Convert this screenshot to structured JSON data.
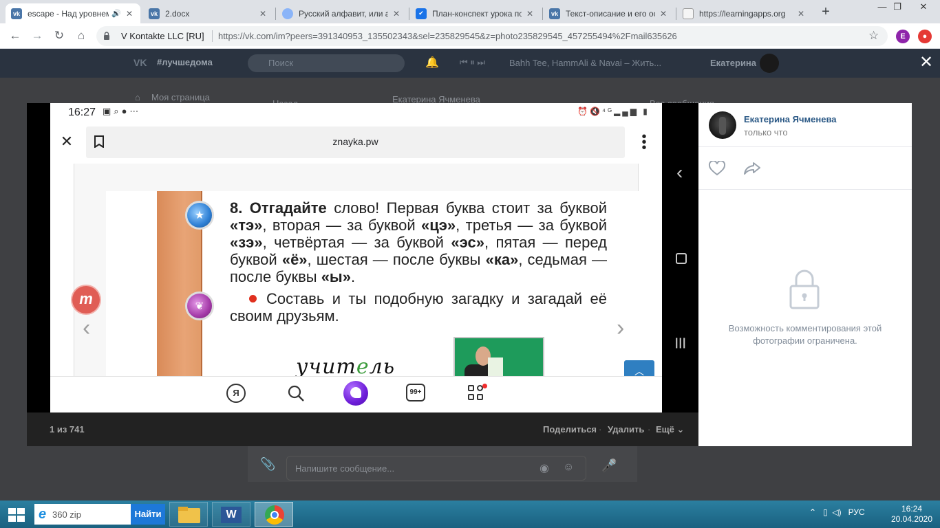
{
  "browser": {
    "tabs": [
      {
        "title": "escape - Над уровнем",
        "favicon": "vk-icon",
        "active": true,
        "audio": true
      },
      {
        "title": "2.docx",
        "favicon": "vk-icon",
        "active": false
      },
      {
        "title": "Русский алфавит, или азбука",
        "favicon": "globe-icon",
        "active": false
      },
      {
        "title": "План-конспект урока по",
        "favicon": "checkmark-icon",
        "active": false
      },
      {
        "title": "Текст-описание и его особенности",
        "favicon": "vk-icon",
        "active": false
      },
      {
        "title": "https://learningapps.org",
        "favicon": "learningapps-icon",
        "active": false
      }
    ],
    "new_tab": "+",
    "window": {
      "minimize": "—",
      "maximize": "❐",
      "close": "✕"
    },
    "site_name": "V Kontakte LLC [RU]",
    "url": "https://vk.com/im?peers=391340953_135502343&sel=235829545&z=photo235829545_457255494%2Fmail635626",
    "profile_letter": "E"
  },
  "vk": {
    "header": {
      "hashtag": "#лучшедома",
      "search_placeholder": "Поиск",
      "now_playing": "Bahh Tee, HammAli & Navai – Жить...",
      "user_name": "Екатерина"
    },
    "bg": {
      "my_page": "Моя страница",
      "back": "Назад",
      "chat_name": "Екатерина Ячменева",
      "all_messages": "Все сообщения",
      "message_placeholder": "Напишите сообщение..."
    }
  },
  "viewer": {
    "phone": {
      "time": "16:27",
      "domain": "znayka.pw",
      "book": {
        "task_number": "8.",
        "task_bold": "Отгадайте",
        "task_parts": [
          {
            "t": " слово! Первая буква стоит за буквой ",
            "b": false
          },
          {
            "t": "«тэ»",
            "b": true
          },
          {
            "t": ", вторая — за буквой ",
            "b": false
          },
          {
            "t": "«цэ»",
            "b": true
          },
          {
            "t": ", третья — за буквой ",
            "b": false
          },
          {
            "t": "«зэ»",
            "b": true
          },
          {
            "t": ", четвёртая — за буквой ",
            "b": false
          },
          {
            "t": "«эс»",
            "b": true
          },
          {
            "t": ", пятая — перед буквой ",
            "b": false
          },
          {
            "t": "«ё»",
            "b": true
          },
          {
            "t": ", шестая — после буквы ",
            "b": false
          },
          {
            "t": "«ка»",
            "b": true
          },
          {
            "t": ", седьмая — после буквы ",
            "b": false
          },
          {
            "t": "«ы»",
            "b": true
          },
          {
            "t": ".",
            "b": false
          }
        ],
        "subtask": "Составь и ты подобную загадку и загадай её своим друзьям.",
        "handwritten_a": "учит",
        "handwritten_b": "е",
        "handwritten_c": "ль"
      },
      "counter_badge": "99+",
      "yandex_letter": "Я"
    },
    "counter": "1 из 741",
    "actions": {
      "share": "Поделиться",
      "delete": "Удалить",
      "more": "Ещё"
    },
    "separator": "·"
  },
  "panel": {
    "author": "Екатерина Ячменева",
    "time": "только что",
    "restricted": "Возможность комментирования этой фотографии ограничена."
  },
  "taskbar": {
    "search_value": "360 zip",
    "search_button": "Найти",
    "lang": "РУС",
    "time": "16:24",
    "date": "20.04.2020"
  },
  "colors": {
    "vk_blue": "#2a5885",
    "accent": "#1d78d8",
    "orange_strip": "#e8a476"
  }
}
